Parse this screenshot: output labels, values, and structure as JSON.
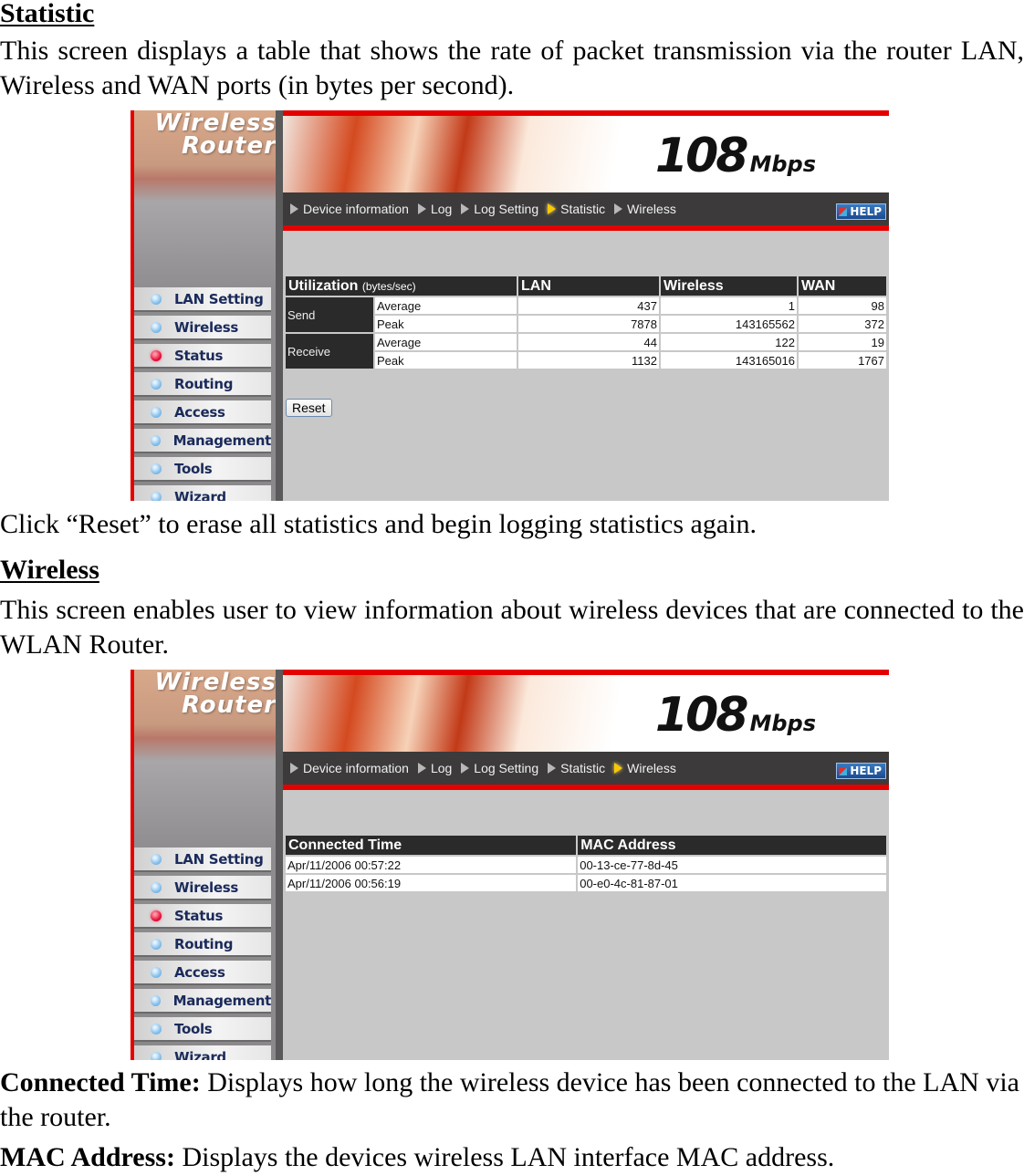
{
  "section1": {
    "heading": "Statistic",
    "intro": "This screen displays a table that shows the rate of packet transmission via the router LAN, Wireless and WAN ports (in bytes per second).",
    "after": "Click “Reset” to erase all statistics and begin logging statistics again."
  },
  "section2": {
    "heading": "Wireless",
    "intro": "This screen enables user to view information about wireless devices that are connected to the WLAN Router.",
    "def1_term": "Connected Time:",
    "def1_text": " Displays how long the wireless device has been connected to the LAN via the router.",
    "def2_term": "MAC Address:",
    "def2_text": " Displays the devices wireless LAN interface MAC address."
  },
  "router": {
    "logo_line1": "Wireless",
    "logo_line2": "Router",
    "speed": "108",
    "speed_unit": "Mbps",
    "help_label": "HELP",
    "nav": [
      "Device information",
      "Log",
      "Log Setting",
      "Statistic",
      "Wireless"
    ],
    "menu": [
      "LAN Setting",
      "Wireless",
      "Status",
      "Routing",
      "Access",
      "Management",
      "Tools",
      "Wizard"
    ],
    "active_menu": "Status"
  },
  "statistic_screen": {
    "active_nav": "Statistic",
    "header": {
      "title": "Utilization",
      "unit": "(bytes/sec)",
      "cols": [
        "LAN",
        "Wireless",
        "WAN"
      ]
    },
    "groups": [
      {
        "label": "Send",
        "rows": [
          {
            "metric": "Average",
            "values": [
              "437",
              "1",
              "98"
            ]
          },
          {
            "metric": "Peak",
            "values": [
              "7878",
              "143165562",
              "372"
            ]
          }
        ]
      },
      {
        "label": "Receive",
        "rows": [
          {
            "metric": "Average",
            "values": [
              "44",
              "122",
              "19"
            ]
          },
          {
            "metric": "Peak",
            "values": [
              "1132",
              "143165016",
              "1767"
            ]
          }
        ]
      }
    ],
    "reset_label": "Reset"
  },
  "wireless_screen": {
    "active_nav": "Wireless",
    "cols": [
      "Connected Time",
      "MAC Address"
    ],
    "rows": [
      [
        "Apr/11/2006 00:57:22",
        "00-13-ce-77-8d-45"
      ],
      [
        "Apr/11/2006 00:56:19",
        "00-e0-4c-81-87-01"
      ]
    ]
  }
}
